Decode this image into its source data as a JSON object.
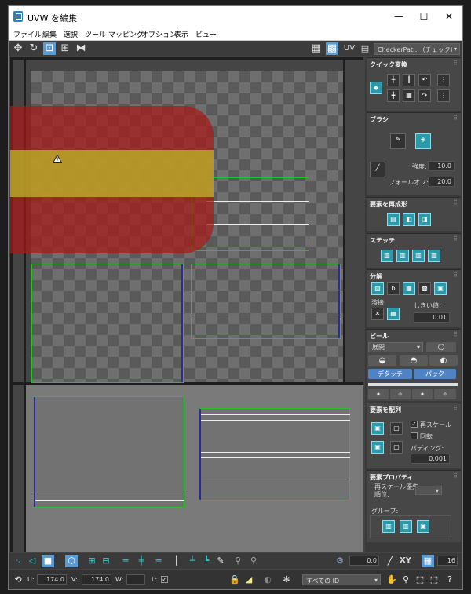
{
  "window": {
    "title": "UVW を編集",
    "minimize": "—",
    "maximize": "☐",
    "close": "✕"
  },
  "menu": [
    "ファイル",
    "編集",
    "選択",
    "ツール",
    "マッピング",
    "オプション",
    "表示",
    "ビュー"
  ],
  "toolbar": {
    "uv_label": "UV",
    "texture_dropdown": "CheckerPat...（チェック）"
  },
  "panels": {
    "quick_transform": {
      "title": "クイック変換"
    },
    "brush": {
      "title": "ブラシ",
      "strength_label": "強度:",
      "strength_value": "10.0",
      "falloff_label": "フォールオフ:",
      "falloff_value": "20.0"
    },
    "reshape": {
      "title": "要素を再成形"
    },
    "stitch": {
      "title": "ステッチ"
    },
    "explode": {
      "title": "分解",
      "weld_label": "溶接",
      "threshold_label": "しきい値:",
      "threshold_value": "0.01"
    },
    "peel": {
      "title": "ピール",
      "mode_select": "展開",
      "detach_button": "デタッチ",
      "pack_button": "パック"
    },
    "arrange": {
      "title": "要素を配列",
      "rescale_label": "再スケール",
      "rotate_label": "回転",
      "padding_label": "パディング:",
      "padding_value": "0.001"
    },
    "properties": {
      "title": "要素プロパティ",
      "rescale_priority_label": "再スケール優先順位:",
      "group_label": "グループ:"
    }
  },
  "bottom": {
    "angle_value": "0.0",
    "xy_label": "XY",
    "grid_value": "16",
    "u_label": "U:",
    "u_value": "174.0",
    "v_label": "V:",
    "v_value": "174.0",
    "w_label": "W:",
    "w_value": "",
    "l_label": "L:",
    "id_select": "すべての ID"
  }
}
